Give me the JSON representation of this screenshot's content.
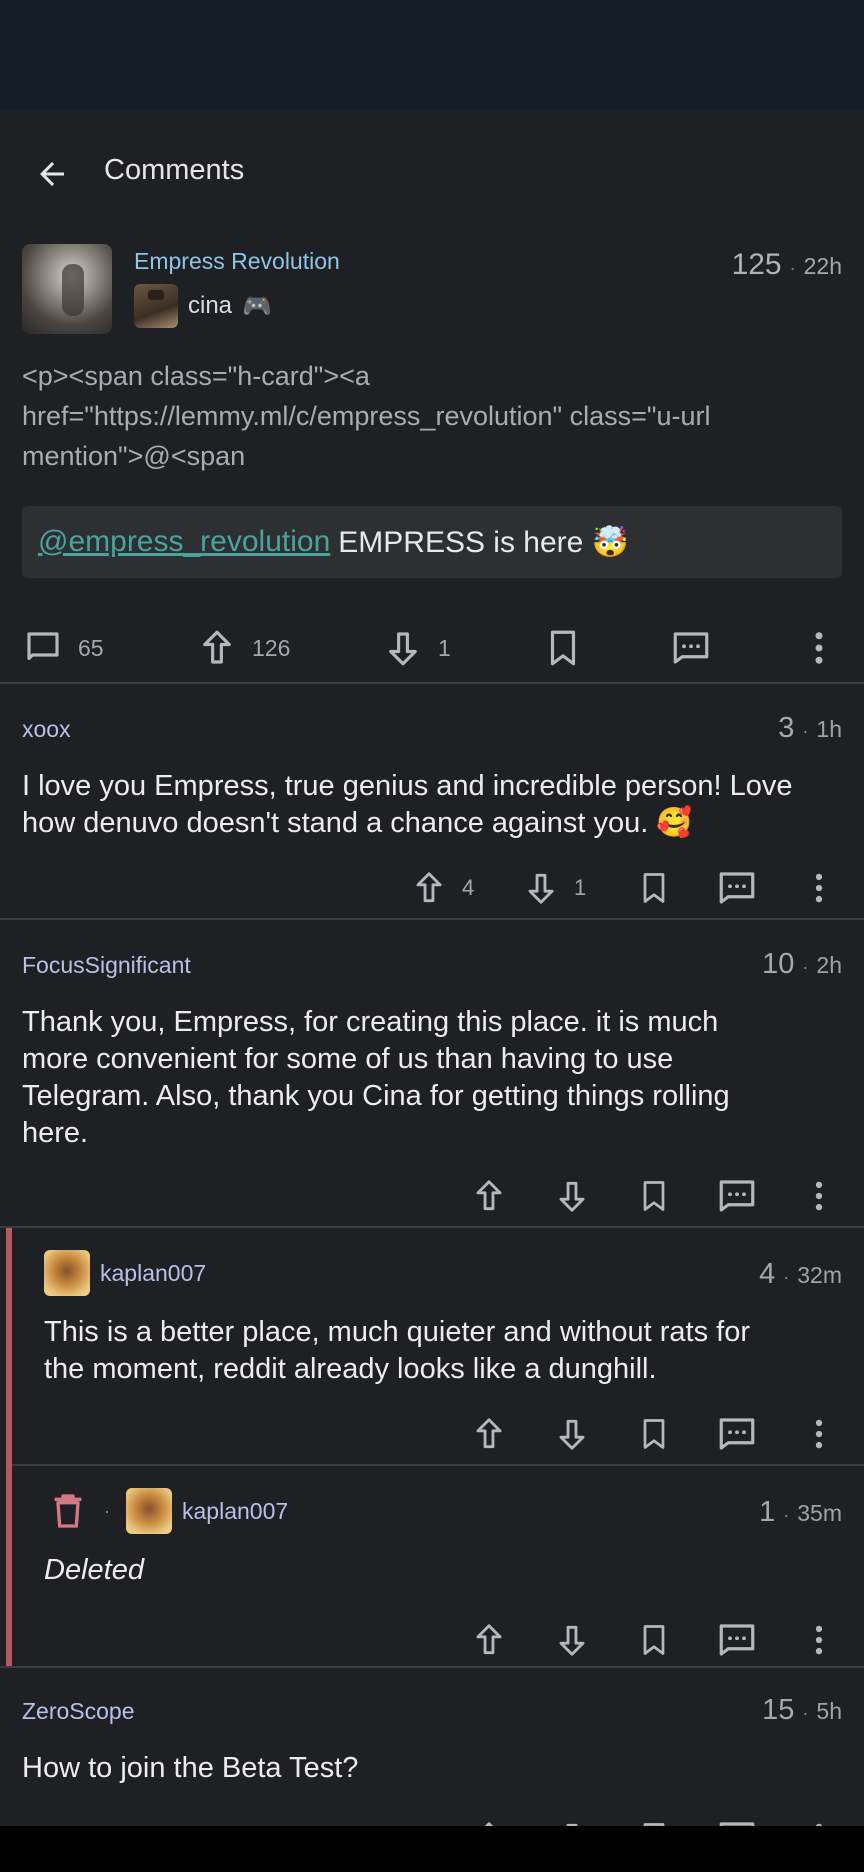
{
  "app_bar": {
    "title": "Comments"
  },
  "post": {
    "community": "Empress Revolution",
    "author": "cina",
    "author_badge": "🎮",
    "score": "125",
    "age": "22h",
    "body_raw_1": "<p><span class=\"h-card\"><a",
    "body_raw_2": "href=\"https://lemmy.ml/c/empress_revolution\" class=\"u-url",
    "body_raw_3": "mention\">@<span",
    "quote_mention": "@empress_revolution",
    "quote_text": "EMPRESS is here 🤯",
    "comments_count": "65",
    "upvotes": "126",
    "downvotes": "1"
  },
  "comments": [
    {
      "user": "xoox",
      "score": "3",
      "age": "1h",
      "body_1": "I love you Empress, true genius and incredible person! Love",
      "body_2": "how denuvo doesn't stand a chance against you. 🥰",
      "upvotes": "4",
      "downvotes": "1"
    },
    {
      "user": "FocusSignificant",
      "score": "10",
      "age": "2h",
      "body_1": "Thank you, Empress, for creating this place. it is much",
      "body_2": "more convenient for some of us than having to use",
      "body_3": "Telegram. Also, thank you Cina for getting things rolling",
      "body_4": "here."
    },
    {
      "user": "kaplan007",
      "score": "4",
      "age": "32m",
      "body_1": "This is a better place, much quieter and without rats for",
      "body_2": "the moment, reddit already looks like a dunghill."
    },
    {
      "user": "kaplan007",
      "score": "1",
      "age": "35m",
      "body_1": "Deleted"
    },
    {
      "user": "ZeroScope",
      "score": "15",
      "age": "5h",
      "body_1": "How to join the Beta Test?"
    }
  ],
  "colors": {
    "accent_link": "#4aa39a",
    "community": "#8ec5e6",
    "thread_bar": "#b25a64"
  }
}
